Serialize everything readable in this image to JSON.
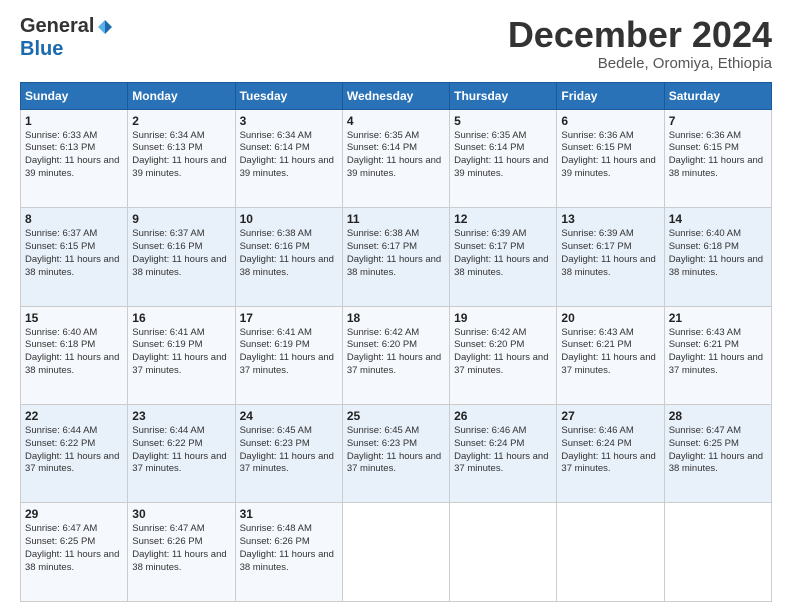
{
  "header": {
    "logo_general": "General",
    "logo_blue": "Blue",
    "month_title": "December 2024",
    "location": "Bedele, Oromiya, Ethiopia"
  },
  "weekdays": [
    "Sunday",
    "Monday",
    "Tuesday",
    "Wednesday",
    "Thursday",
    "Friday",
    "Saturday"
  ],
  "weeks": [
    [
      {
        "day": "1",
        "sunrise": "6:33 AM",
        "sunset": "6:13 PM",
        "daylight": "11 hours and 39 minutes."
      },
      {
        "day": "2",
        "sunrise": "6:34 AM",
        "sunset": "6:13 PM",
        "daylight": "11 hours and 39 minutes."
      },
      {
        "day": "3",
        "sunrise": "6:34 AM",
        "sunset": "6:14 PM",
        "daylight": "11 hours and 39 minutes."
      },
      {
        "day": "4",
        "sunrise": "6:35 AM",
        "sunset": "6:14 PM",
        "daylight": "11 hours and 39 minutes."
      },
      {
        "day": "5",
        "sunrise": "6:35 AM",
        "sunset": "6:14 PM",
        "daylight": "11 hours and 39 minutes."
      },
      {
        "day": "6",
        "sunrise": "6:36 AM",
        "sunset": "6:15 PM",
        "daylight": "11 hours and 39 minutes."
      },
      {
        "day": "7",
        "sunrise": "6:36 AM",
        "sunset": "6:15 PM",
        "daylight": "11 hours and 38 minutes."
      }
    ],
    [
      {
        "day": "8",
        "sunrise": "6:37 AM",
        "sunset": "6:15 PM",
        "daylight": "11 hours and 38 minutes."
      },
      {
        "day": "9",
        "sunrise": "6:37 AM",
        "sunset": "6:16 PM",
        "daylight": "11 hours and 38 minutes."
      },
      {
        "day": "10",
        "sunrise": "6:38 AM",
        "sunset": "6:16 PM",
        "daylight": "11 hours and 38 minutes."
      },
      {
        "day": "11",
        "sunrise": "6:38 AM",
        "sunset": "6:17 PM",
        "daylight": "11 hours and 38 minutes."
      },
      {
        "day": "12",
        "sunrise": "6:39 AM",
        "sunset": "6:17 PM",
        "daylight": "11 hours and 38 minutes."
      },
      {
        "day": "13",
        "sunrise": "6:39 AM",
        "sunset": "6:17 PM",
        "daylight": "11 hours and 38 minutes."
      },
      {
        "day": "14",
        "sunrise": "6:40 AM",
        "sunset": "6:18 PM",
        "daylight": "11 hours and 38 minutes."
      }
    ],
    [
      {
        "day": "15",
        "sunrise": "6:40 AM",
        "sunset": "6:18 PM",
        "daylight": "11 hours and 38 minutes."
      },
      {
        "day": "16",
        "sunrise": "6:41 AM",
        "sunset": "6:19 PM",
        "daylight": "11 hours and 37 minutes."
      },
      {
        "day": "17",
        "sunrise": "6:41 AM",
        "sunset": "6:19 PM",
        "daylight": "11 hours and 37 minutes."
      },
      {
        "day": "18",
        "sunrise": "6:42 AM",
        "sunset": "6:20 PM",
        "daylight": "11 hours and 37 minutes."
      },
      {
        "day": "19",
        "sunrise": "6:42 AM",
        "sunset": "6:20 PM",
        "daylight": "11 hours and 37 minutes."
      },
      {
        "day": "20",
        "sunrise": "6:43 AM",
        "sunset": "6:21 PM",
        "daylight": "11 hours and 37 minutes."
      },
      {
        "day": "21",
        "sunrise": "6:43 AM",
        "sunset": "6:21 PM",
        "daylight": "11 hours and 37 minutes."
      }
    ],
    [
      {
        "day": "22",
        "sunrise": "6:44 AM",
        "sunset": "6:22 PM",
        "daylight": "11 hours and 37 minutes."
      },
      {
        "day": "23",
        "sunrise": "6:44 AM",
        "sunset": "6:22 PM",
        "daylight": "11 hours and 37 minutes."
      },
      {
        "day": "24",
        "sunrise": "6:45 AM",
        "sunset": "6:23 PM",
        "daylight": "11 hours and 37 minutes."
      },
      {
        "day": "25",
        "sunrise": "6:45 AM",
        "sunset": "6:23 PM",
        "daylight": "11 hours and 37 minutes."
      },
      {
        "day": "26",
        "sunrise": "6:46 AM",
        "sunset": "6:24 PM",
        "daylight": "11 hours and 37 minutes."
      },
      {
        "day": "27",
        "sunrise": "6:46 AM",
        "sunset": "6:24 PM",
        "daylight": "11 hours and 37 minutes."
      },
      {
        "day": "28",
        "sunrise": "6:47 AM",
        "sunset": "6:25 PM",
        "daylight": "11 hours and 38 minutes."
      }
    ],
    [
      {
        "day": "29",
        "sunrise": "6:47 AM",
        "sunset": "6:25 PM",
        "daylight": "11 hours and 38 minutes."
      },
      {
        "day": "30",
        "sunrise": "6:47 AM",
        "sunset": "6:26 PM",
        "daylight": "11 hours and 38 minutes."
      },
      {
        "day": "31",
        "sunrise": "6:48 AM",
        "sunset": "6:26 PM",
        "daylight": "11 hours and 38 minutes."
      },
      null,
      null,
      null,
      null
    ]
  ]
}
